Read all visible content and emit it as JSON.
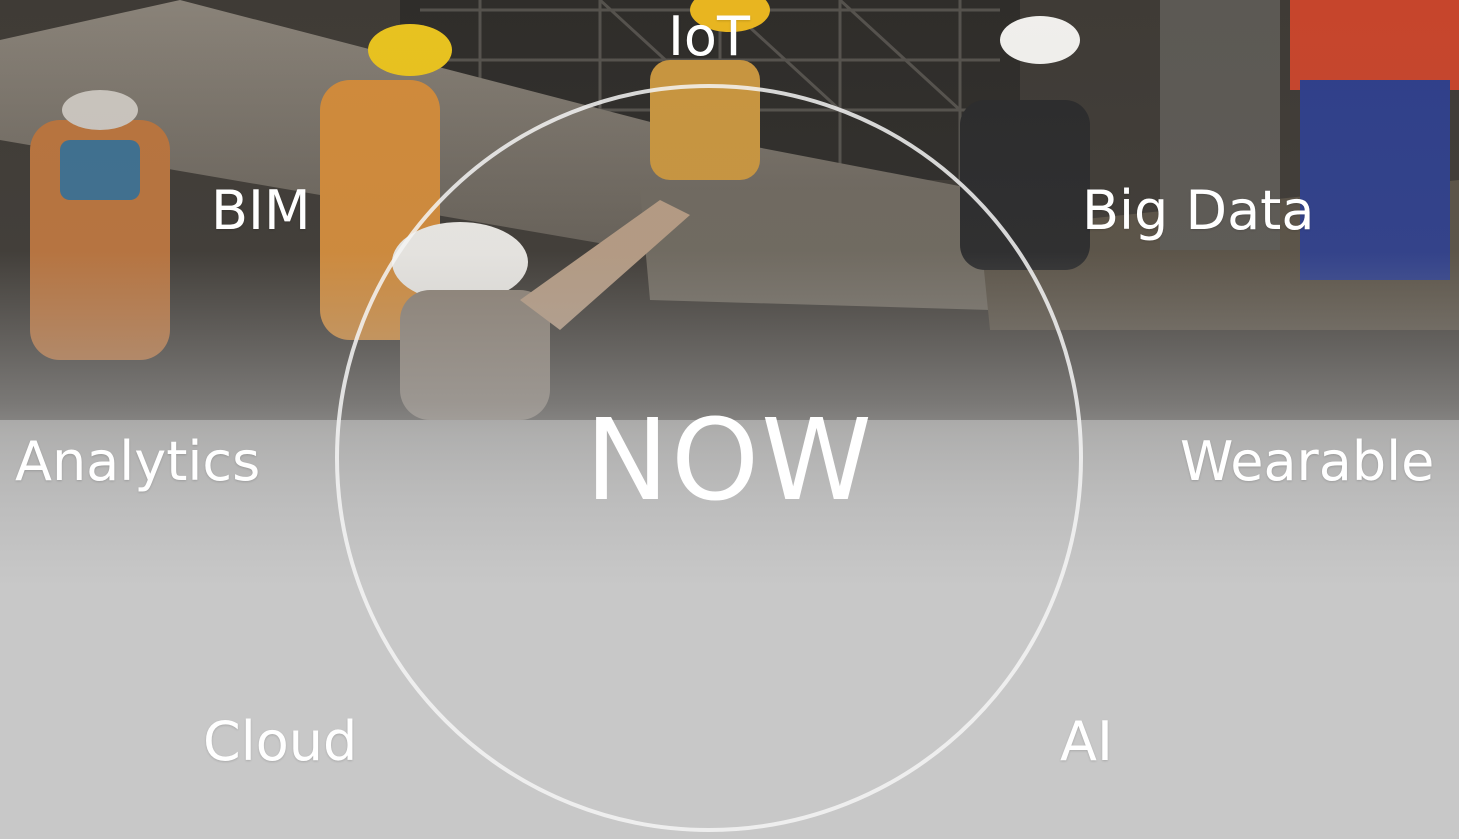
{
  "slide": {
    "center_text": "NOW",
    "topics": [
      {
        "id": "iot",
        "label": "IoT"
      },
      {
        "id": "bim",
        "label": "BIM"
      },
      {
        "id": "big-data",
        "label": "Big Data"
      },
      {
        "id": "analytics",
        "label": "Analytics"
      },
      {
        "id": "wearable",
        "label": "Wearable"
      },
      {
        "id": "cloud",
        "label": "Cloud"
      },
      {
        "id": "ai",
        "label": "AI"
      }
    ],
    "background_photo": "construction-workers-photo",
    "colors": {
      "text": "#ffffff",
      "ring": "#f5f5f5",
      "background_bottom": "#d6d6d6"
    }
  }
}
